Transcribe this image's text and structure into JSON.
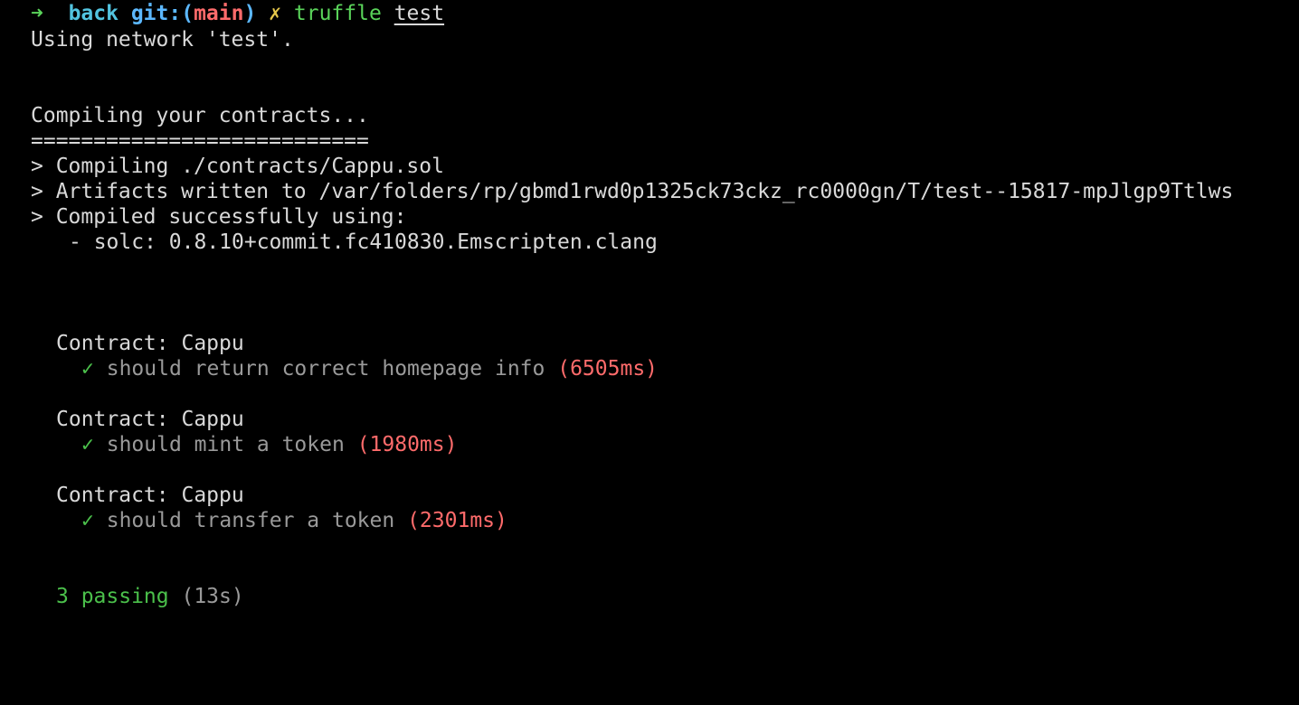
{
  "prompt": {
    "arrow": "➜",
    "directory": "back",
    "git_prefix": "git:",
    "open_paren": "(",
    "branch": "main",
    "close_paren": ")",
    "dirty_marker": "✗",
    "command": "truffle",
    "argument": "test"
  },
  "output": {
    "network_line": "Using network 'test'.",
    "compiling_header": "Compiling your contracts...",
    "separator": "===========================",
    "compile_lines": [
      "> Compiling ./contracts/Cappu.sol",
      "> Artifacts written to /var/folders/rp/gbmd1rwd0p1325ck73ckz_rc0000gn/T/test--15817-mpJlgp9Ttlws",
      "> Compiled successfully using:"
    ],
    "solc_line": "- solc: 0.8.10+commit.fc410830.Emscripten.clang"
  },
  "tests": [
    {
      "suite": "Contract: Cappu",
      "check": "✓",
      "description": "should return correct homepage info",
      "duration": "(6505ms)"
    },
    {
      "suite": "Contract: Cappu",
      "check": "✓",
      "description": "should mint a token",
      "duration": "(1980ms)"
    },
    {
      "suite": "Contract: Cappu",
      "check": "✓",
      "description": "should transfer a token",
      "duration": "(2301ms)"
    }
  ],
  "summary": {
    "passing": "3 passing",
    "duration": "(13s)"
  },
  "colors": {
    "background": "#000000",
    "text": "#d9d9d9",
    "success_green": "#4bc04b",
    "timing_red": "#ff6b6b",
    "directory_cyan": "#52c4e0",
    "dirty_yellow": "#e5c74a"
  }
}
